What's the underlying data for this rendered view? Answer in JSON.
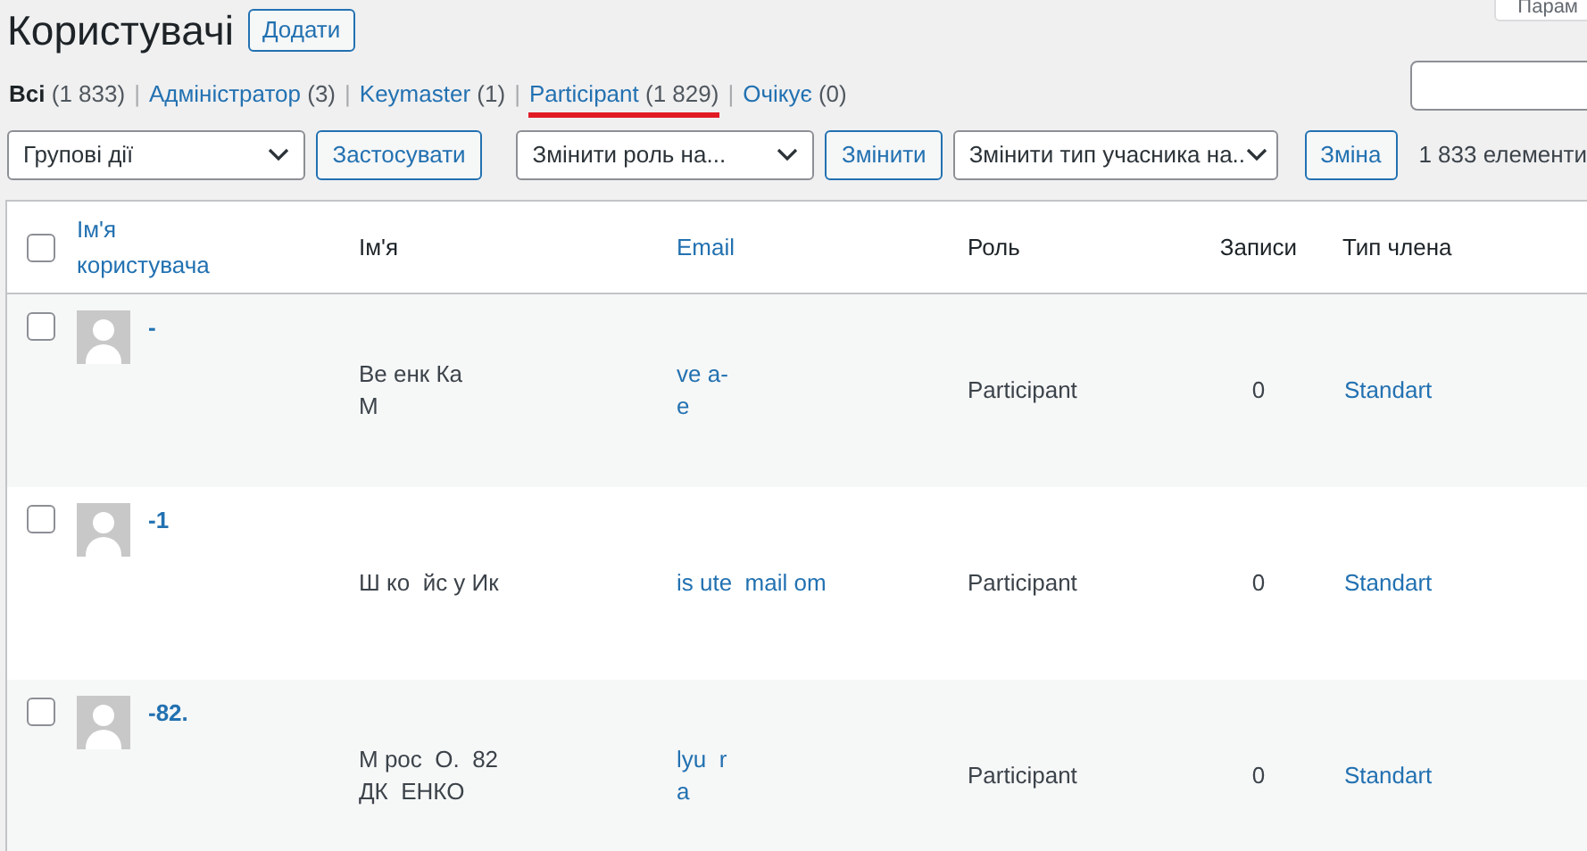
{
  "title": "Користувачі",
  "add_button": "Додати",
  "screen_options": "Парам",
  "filters": [
    {
      "label": "Всі",
      "count": "(1 833)",
      "selected": true,
      "highlighted": false
    },
    {
      "separator": "|",
      "label": "Адміністратор",
      "count": "(3)",
      "selected": false,
      "highlighted": false
    },
    {
      "separator": "|",
      "label": "Keymaster",
      "count": "(1)",
      "selected": false,
      "highlighted": false
    },
    {
      "separator": "|",
      "label": "Participant",
      "count": "(1 829)",
      "selected": false,
      "highlighted": true
    },
    {
      "separator": "|",
      "label": "Очікує",
      "count": "(0)",
      "selected": false,
      "highlighted": false
    }
  ],
  "bulk_actions": {
    "select": "Групові дії",
    "apply": "Застосувати"
  },
  "change_role": {
    "select": "Змінити роль на...",
    "button": "Змінити"
  },
  "change_member_type": {
    "select": "Змінити тип учасника на..",
    "button": "Зміна"
  },
  "items_count": "1 833 елементи",
  "table": {
    "select_all_checked": false,
    "columns": [
      {
        "label": "Ім'я користувача",
        "kind": "sortable"
      },
      {
        "label": "Ім'я",
        "kind": "plain"
      },
      {
        "label": "Email",
        "kind": "sortable"
      },
      {
        "label": "Роль",
        "kind": "plain"
      },
      {
        "label": "Записи",
        "kind": "plain"
      },
      {
        "label": "Тип члена",
        "kind": "plain"
      }
    ],
    "rows": [
      {
        "username": "-",
        "name": [
          "Ве енк Ка",
          "М"
        ],
        "email": [
          "ve a-",
          "e"
        ],
        "role": "Participant",
        "posts": "0",
        "member_type": "Standart",
        "checked": false
      },
      {
        "username": "-1",
        "name": [
          "Ш ко  йс у Ик"
        ],
        "email": [
          "is ute  mail om"
        ],
        "role": "Participant",
        "posts": "0",
        "member_type": "Standart",
        "checked": false
      },
      {
        "username": "-82.",
        "name": [
          "М рос  О.  82",
          "ДК  ЕНКО"
        ],
        "email": [
          "lyu  r",
          "a"
        ],
        "role": "Participant",
        "posts": "0",
        "member_type": "Standart",
        "checked": false
      }
    ]
  }
}
